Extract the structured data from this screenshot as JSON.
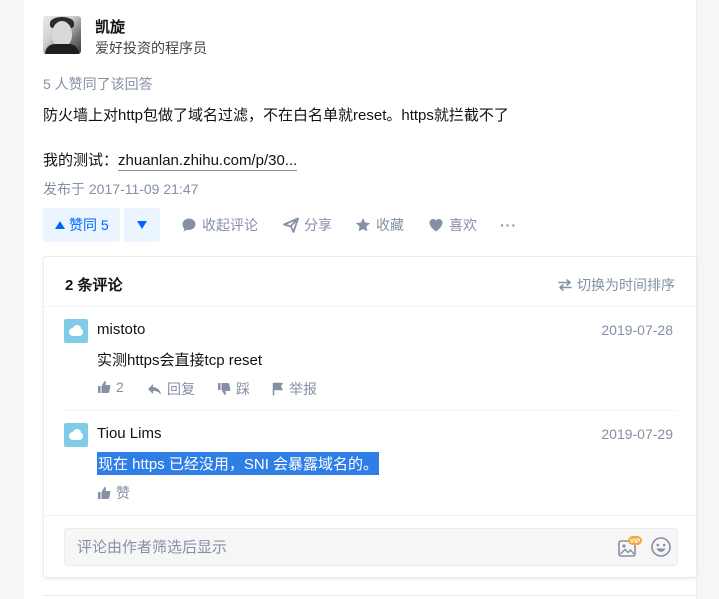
{
  "author": {
    "name": "凯旋",
    "bio": "爱好投资的程序员"
  },
  "answer": {
    "votes_summary": "5 人赞同了该回答",
    "text": "防火墙上对http包做了域名过滤，不在白名单就reset。https就拦截不了",
    "link_prefix": "我的测试：",
    "link_text": "zhuanlan.zhihu.com/p/30...",
    "post_time": "发布于 2017-11-09 21:47"
  },
  "actions": {
    "vote_up": "赞同 5",
    "collapse_comments": "收起评论",
    "share": "分享",
    "favorite": "收藏",
    "like": "喜欢",
    "more": "···"
  },
  "comments": {
    "count": "2 条评论",
    "sort_toggle": "切换为时间排序",
    "items": [
      {
        "name": "mistoto",
        "date": "2019-07-28",
        "text": "实测https会直接tcp reset",
        "like_count": "2",
        "reply": "回复",
        "dislike": "踩",
        "report": "举报"
      },
      {
        "name": "Tiou Lims",
        "date": "2019-07-29",
        "text": "现在 https 已经没用，SNI 会暴露域名的。",
        "like": "赞"
      }
    ],
    "input_placeholder": "评论由作者筛选后显示",
    "vip_badge": "VIP"
  },
  "colors": {
    "accent": "#0066ff",
    "accent_bg": "#ebf5ff",
    "muted": "#8590a6",
    "selection": "#2f7ee6"
  }
}
